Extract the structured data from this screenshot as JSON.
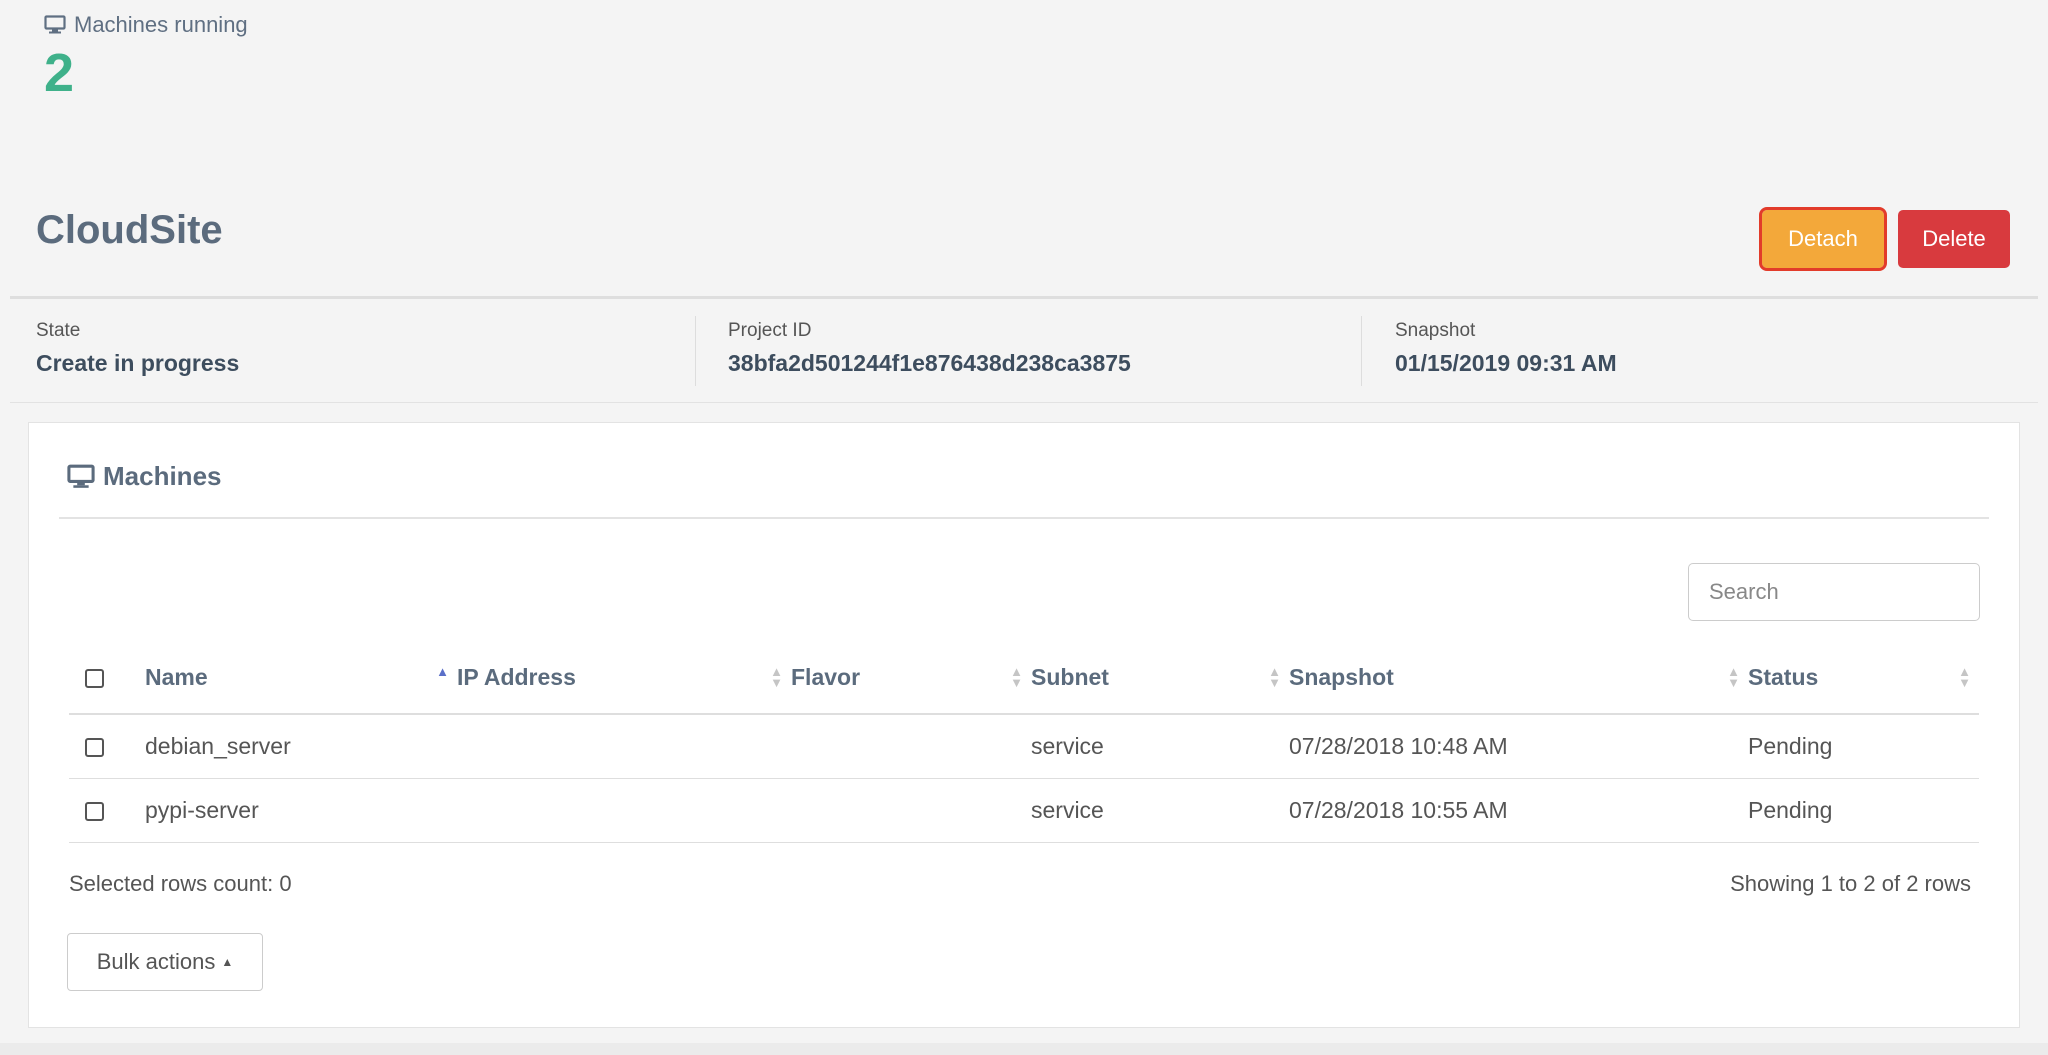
{
  "stats": {
    "machines_running_label": "Machines running",
    "machines_running_value": "2",
    "value_color": "#3fb18a"
  },
  "site": {
    "title": "CloudSite"
  },
  "actions": {
    "detach_label": "Detach",
    "delete_label": "Delete",
    "detach_color": "#f3a83a",
    "delete_color": "#d83a3e"
  },
  "info": {
    "state_label": "State",
    "state_value": "Create in progress",
    "project_id_label": "Project ID",
    "project_id_value": "38bfa2d501244f1e876438d238ca3875",
    "snapshot_label": "Snapshot",
    "snapshot_value": "01/15/2019 09:31 AM"
  },
  "machines": {
    "title": "Machines",
    "search_placeholder": "Search",
    "columns": [
      "Name",
      "IP Address",
      "Flavor",
      "Subnet",
      "Snapshot",
      "Status"
    ],
    "sorted_column": "Name",
    "rows": [
      {
        "name": "debian_server",
        "ip": "",
        "flavor": "",
        "subnet": "service",
        "snapshot": "07/28/2018 10:48 AM",
        "status": "Pending"
      },
      {
        "name": "pypi-server",
        "ip": "",
        "flavor": "",
        "subnet": "service",
        "snapshot": "07/28/2018 10:55 AM",
        "status": "Pending"
      }
    ],
    "selected_count_text": "Selected rows count: 0",
    "showing_text": "Showing 1 to 2 of 2 rows",
    "bulk_actions_label": "Bulk actions"
  },
  "icons": {
    "monitor": "monitor-icon",
    "sort": "sort-icon",
    "caret": "caret-up-icon"
  }
}
